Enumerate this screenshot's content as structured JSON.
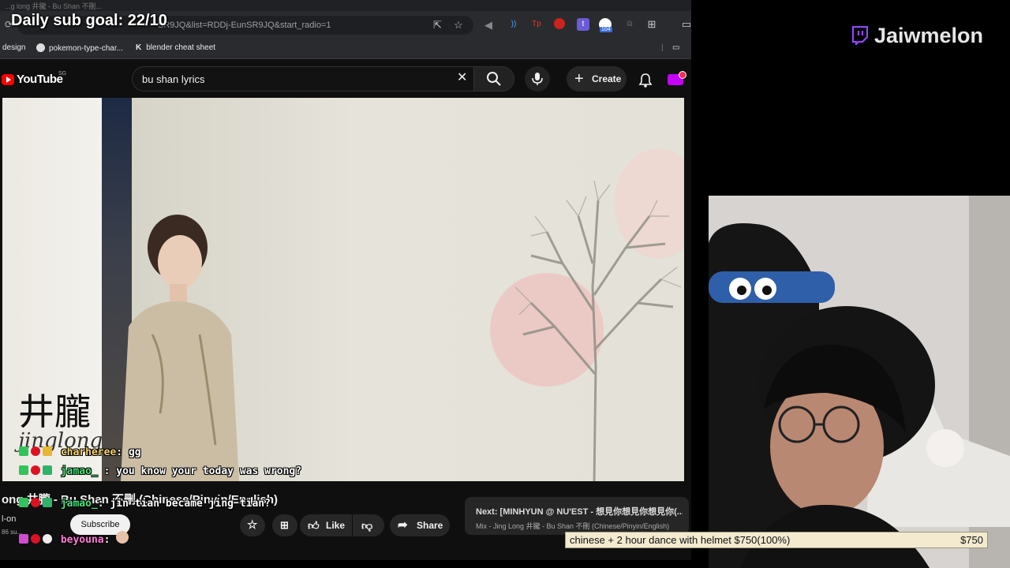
{
  "overlay": {
    "sub_goal": "Daily sub goal: 22/10",
    "channel_name": "Jaiwmelon"
  },
  "browser": {
    "tab_title": "...g long 井朧 - Bu Shan 不刪...",
    "url": "SR9JQ&list=RDDj-EunSR9JQ&start_radio=1",
    "extension_badge": "104",
    "bookmarks": [
      "design",
      "pokemon-type-char...",
      "blender cheat sheet"
    ]
  },
  "youtube": {
    "logo_text": "YouTube",
    "region": "SG",
    "search_value": "bu shan lyrics",
    "create_label": "Create",
    "video_overlay_cn": "井朧",
    "video_overlay_roman": "jinglong",
    "video_title": "ong 井朧 - Bu Shan 不刪 (Chinese/Pinyin/English)",
    "channel": "l-on",
    "subscribers": "86 su...",
    "subscribe_label": "Subscribe",
    "like_label": "Like",
    "share_label": "Share",
    "next_title": "Next: [MINHYUN @ NU'EST - 想見你想見你想見你(...",
    "next_sub": "Mix - Jing Long 井朧 - Bu Shan 不刪 (Chinese/Pinyin/English)"
  },
  "chat": [
    {
      "user": "charheree",
      "message": "gg",
      "user_color": "#f5d36a"
    },
    {
      "user": "jamao_",
      "message": "you know your today was wrong?",
      "user_color": "#48e27a"
    },
    {
      "user": "jamao_",
      "message": "jin tian became jing tian?",
      "user_color": "#48e27a"
    },
    {
      "user": "beyouna",
      "message": "",
      "user_color": "#ff7ad9"
    }
  ],
  "donation_goal": {
    "label": "chinese + 2 hour dance with helmet   $750(100%)",
    "amount": "$750",
    "progress": 1.0
  },
  "colors": {
    "twitch_purple": "#9146ff",
    "youtube_red": "#ff0000"
  }
}
